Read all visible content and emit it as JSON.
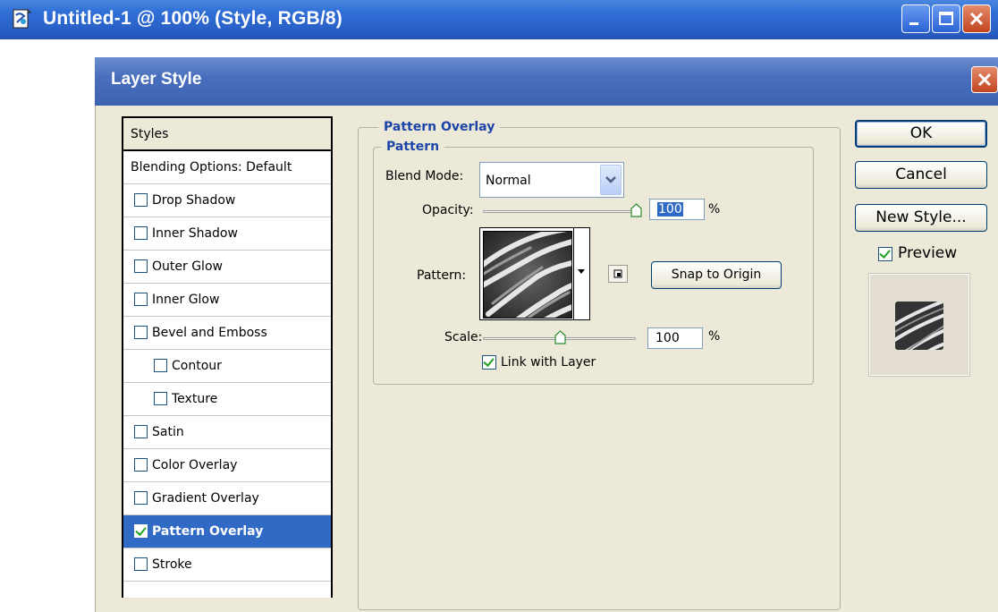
{
  "window": {
    "title": "Untitled-1 @ 100% (Style, RGB/8)",
    "icon": "photoshop-document-icon"
  },
  "dialog": {
    "title": "Layer Style"
  },
  "styles_list": {
    "header": "Styles",
    "blending": "Blending Options: Default",
    "items": [
      {
        "label": "Drop Shadow",
        "checked": false,
        "indent": false
      },
      {
        "label": "Inner Shadow",
        "checked": false,
        "indent": false
      },
      {
        "label": "Outer Glow",
        "checked": false,
        "indent": false
      },
      {
        "label": "Inner Glow",
        "checked": false,
        "indent": false
      },
      {
        "label": "Bevel and Emboss",
        "checked": false,
        "indent": false
      },
      {
        "label": "Contour",
        "checked": false,
        "indent": true
      },
      {
        "label": "Texture",
        "checked": false,
        "indent": true
      },
      {
        "label": "Satin",
        "checked": false,
        "indent": false
      },
      {
        "label": "Color Overlay",
        "checked": false,
        "indent": false
      },
      {
        "label": "Gradient Overlay",
        "checked": false,
        "indent": false
      },
      {
        "label": "Pattern Overlay",
        "checked": true,
        "indent": false,
        "selected": true
      },
      {
        "label": "Stroke",
        "checked": false,
        "indent": false
      }
    ]
  },
  "panel": {
    "group_title": "Pattern Overlay",
    "subgroup_title": "Pattern",
    "blend_mode_label": "Blend Mode:",
    "blend_mode_value": "Normal",
    "opacity_label": "Opacity:",
    "opacity_value": "100",
    "opacity_fraction": 1.0,
    "percent": "%",
    "pattern_label": "Pattern:",
    "snap_button": "Snap to Origin",
    "scale_label": "Scale:",
    "scale_value": "100",
    "scale_fraction": 0.5,
    "link_label": "Link with Layer",
    "link_checked": true
  },
  "buttons": {
    "ok": "OK",
    "cancel": "Cancel",
    "new_style": "New Style...",
    "preview_label": "Preview",
    "preview_checked": true
  },
  "colors": {
    "selection": "#316ac5",
    "group_title": "#1c45a8",
    "dialog_bg": "#ece9d8"
  }
}
